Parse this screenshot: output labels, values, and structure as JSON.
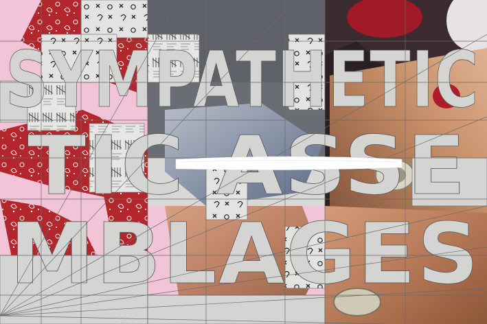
{
  "artwork": {
    "title_lines": [
      "SYMPATHETIC",
      "TIC ASSE",
      "MBLAGES"
    ],
    "palette": {
      "pink": "#f2c4d8",
      "bandana_red": "#b3262b",
      "slate": "#5e6268",
      "tile_grey": "#d4d4d2",
      "skin": "#c7906a",
      "white_stroke": "#ffffff"
    },
    "icons": [
      "paisley-bandana",
      "ringed-hand",
      "tally-marks",
      "x-o-doodles"
    ]
  }
}
